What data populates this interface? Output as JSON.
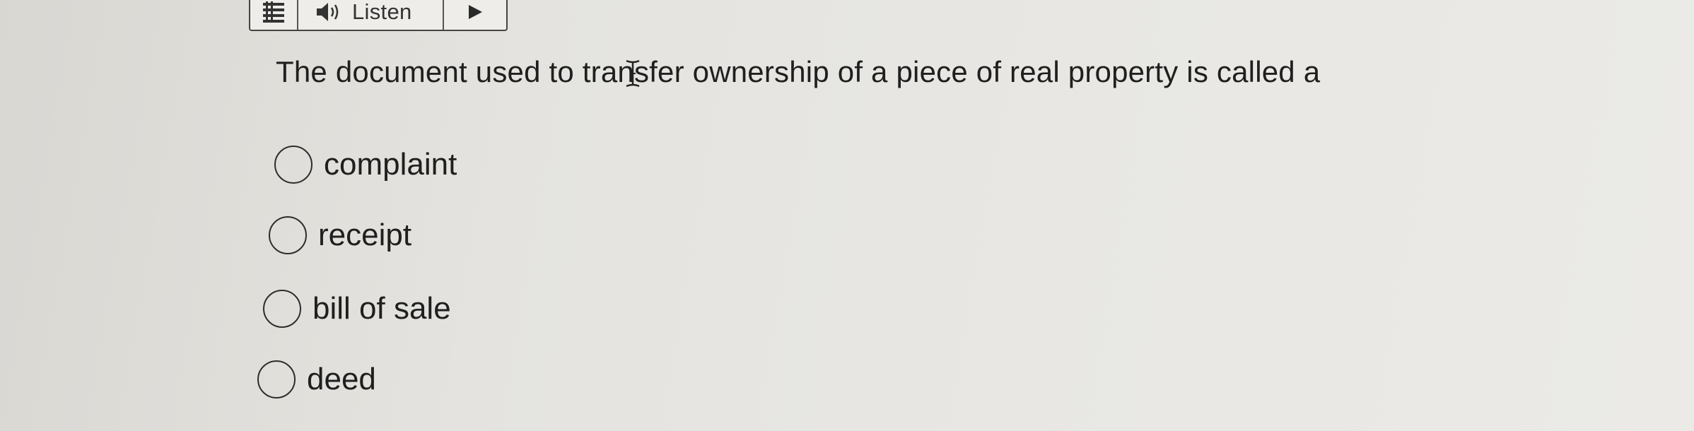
{
  "toolbar": {
    "menu_icon": "menu-lines-icon",
    "listen_icon": "speaker-icon",
    "listen_label": "Listen",
    "play_icon": "play-icon"
  },
  "question": {
    "text": "The document used to transfer ownership of a piece of real property is called a"
  },
  "options": [
    {
      "label": "complaint",
      "selected": false
    },
    {
      "label": "receipt",
      "selected": false
    },
    {
      "label": "bill of sale",
      "selected": false
    },
    {
      "label": "deed",
      "selected": false
    }
  ]
}
